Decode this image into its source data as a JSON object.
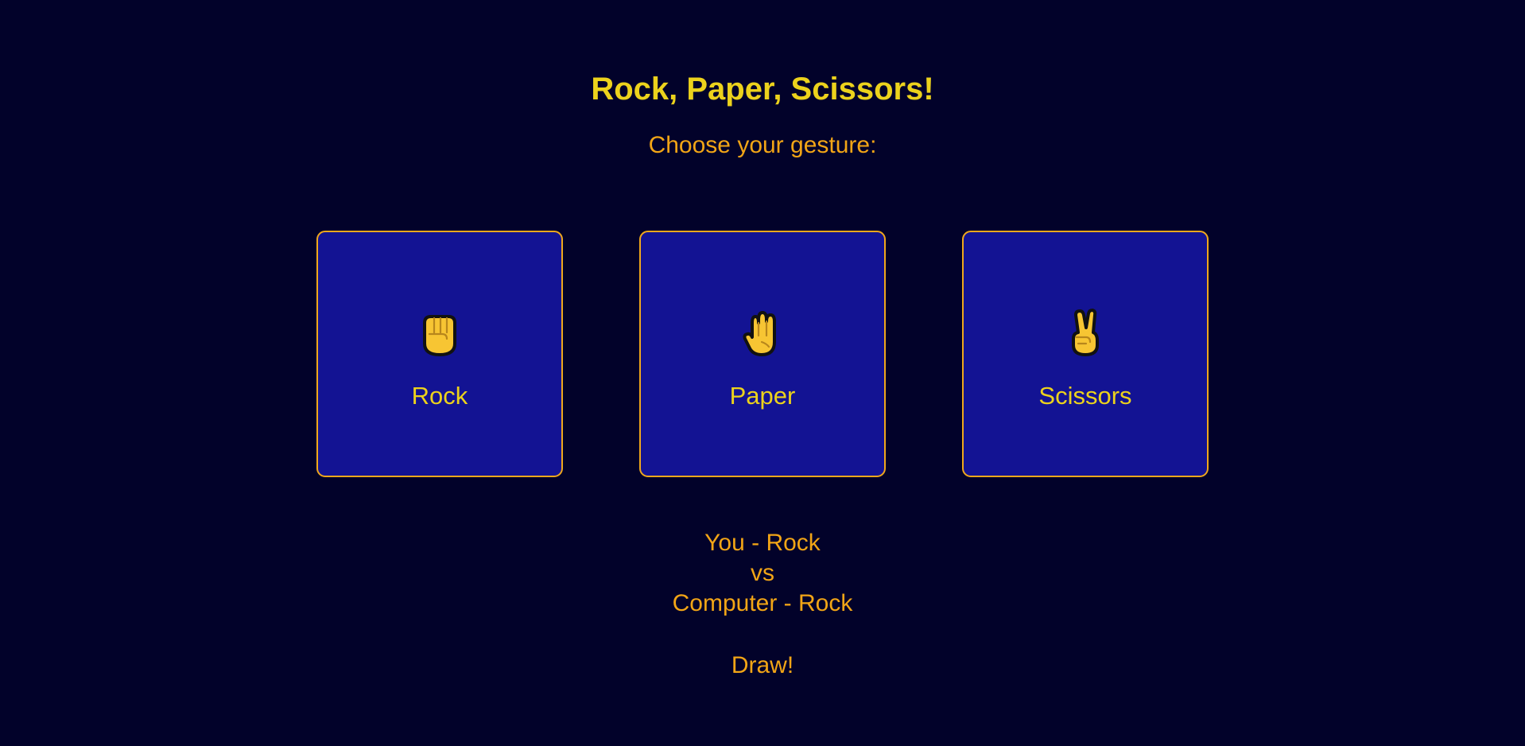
{
  "header": {
    "title": "Rock, Paper, Scissors!",
    "subtitle": "Choose your gesture:"
  },
  "choices": [
    {
      "label": "Rock",
      "icon": "raised-fist-icon"
    },
    {
      "label": "Paper",
      "icon": "raised-hand-icon"
    },
    {
      "label": "Scissors",
      "icon": "victory-hand-icon"
    }
  ],
  "result": {
    "player_line": "You - Rock",
    "versus": "vs",
    "computer_line": "Computer - Rock",
    "outcome": "Draw!"
  },
  "colors": {
    "background": "#02022a",
    "card": "#131393",
    "card_border": "#f0a81c",
    "title": "#ecd21c",
    "text": "#f2a516",
    "emoji_fill": "#f7c533",
    "emoji_outline": "#111111"
  }
}
